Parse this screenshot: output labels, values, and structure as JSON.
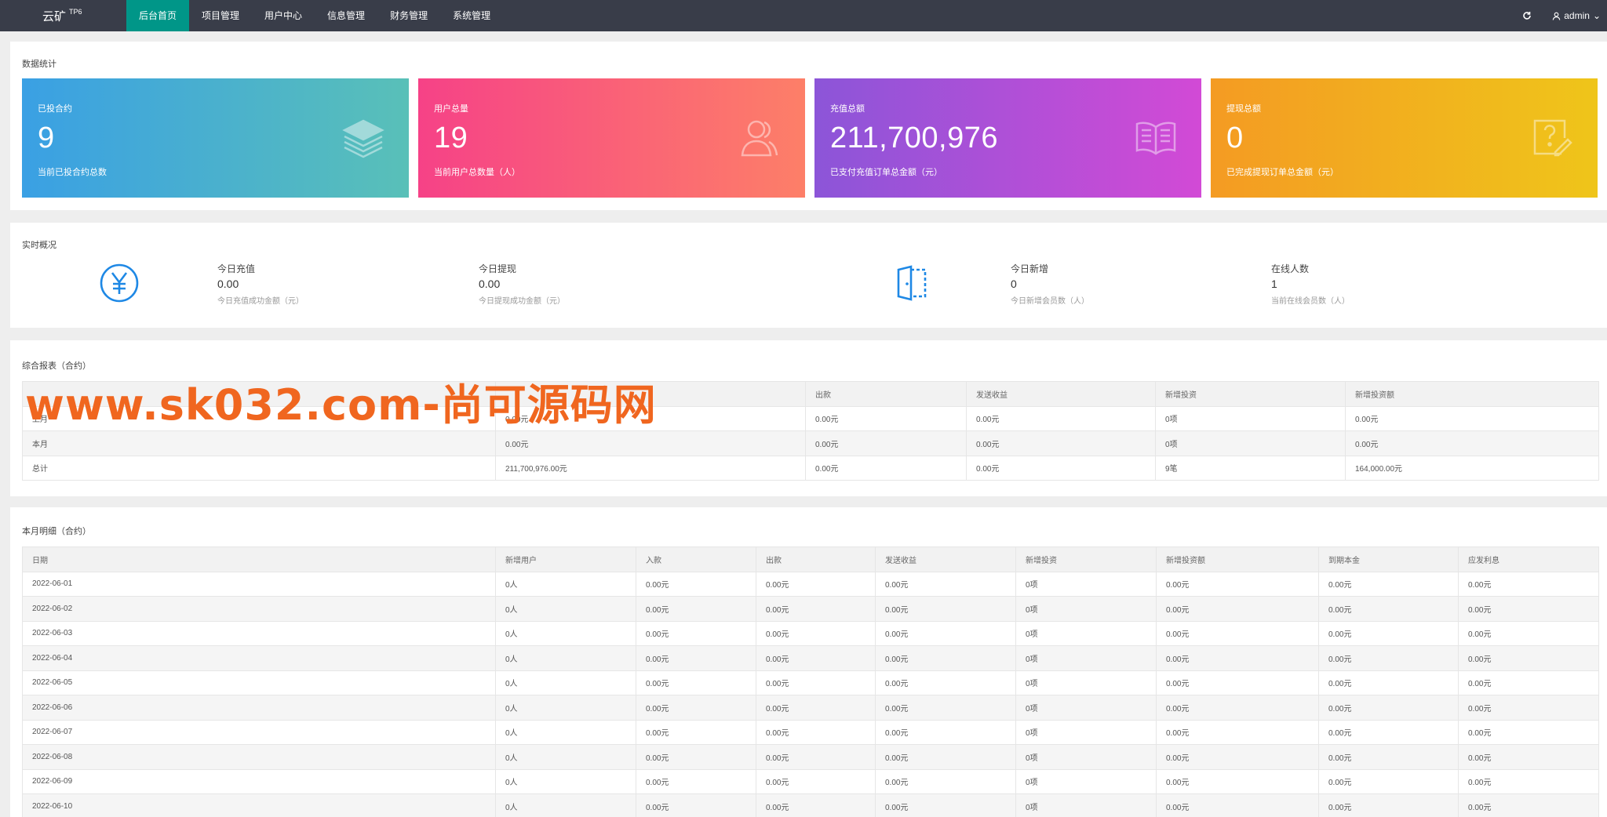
{
  "header": {
    "logo": "云矿",
    "logo_sup": "TP6",
    "nav": [
      "后台首页",
      "项目管理",
      "用户中心",
      "信息管理",
      "财务管理",
      "系统管理"
    ],
    "user": "admin"
  },
  "stats": {
    "title": "数据统计",
    "cards": [
      {
        "label": "已投合约",
        "value": "9",
        "sub": "当前已投合约总数",
        "icon": "stack-icon"
      },
      {
        "label": "用户总量",
        "value": "19",
        "sub": "当前用户总数量（人）",
        "icon": "users-icon"
      },
      {
        "label": "充值总额",
        "value": "211,700,976",
        "sub": "已支付充值订单总金额（元）",
        "icon": "book-icon"
      },
      {
        "label": "提现总额",
        "value": "0",
        "sub": "已完成提现订单总金额（元）",
        "icon": "question-edit-icon"
      }
    ]
  },
  "overview": {
    "title": "实时概况",
    "items": [
      {
        "label": "今日充值",
        "value": "0.00",
        "sub": "今日充值成功金额（元）"
      },
      {
        "label": "今日提现",
        "value": "0.00",
        "sub": "今日提现成功金额（元）"
      },
      {
        "label": "今日新增",
        "value": "0",
        "sub": "今日新增会员数（人）"
      },
      {
        "label": "在线人数",
        "value": "1",
        "sub": "当前在线会员数（人）"
      }
    ]
  },
  "report": {
    "title": "综合报表（合约）",
    "headers": [
      "",
      "",
      "出款",
      "发送收益",
      "新增投资",
      "新增投资额"
    ],
    "rows": [
      [
        "上月",
        "0.00元",
        "0.00元",
        "0.00元",
        "0项",
        "0.00元"
      ],
      [
        "本月",
        "0.00元",
        "0.00元",
        "0.00元",
        "0项",
        "0.00元"
      ],
      [
        "总计",
        "211,700,976.00元",
        "0.00元",
        "0.00元",
        "9笔",
        "164,000.00元"
      ]
    ]
  },
  "watermark": "www.sk032.com-尚可源码网",
  "detail": {
    "title": "本月明细（合约）",
    "headers": [
      "日期",
      "新增用户",
      "入款",
      "出款",
      "发送收益",
      "新增投资",
      "新增投资额",
      "到期本金",
      "应发利息"
    ],
    "rows": [
      [
        "2022-06-01",
        "0人",
        "0.00元",
        "0.00元",
        "0.00元",
        "0项",
        "0.00元",
        "0.00元",
        "0.00元"
      ],
      [
        "2022-06-02",
        "0人",
        "0.00元",
        "0.00元",
        "0.00元",
        "0项",
        "0.00元",
        "0.00元",
        "0.00元"
      ],
      [
        "2022-06-03",
        "0人",
        "0.00元",
        "0.00元",
        "0.00元",
        "0项",
        "0.00元",
        "0.00元",
        "0.00元"
      ],
      [
        "2022-06-04",
        "0人",
        "0.00元",
        "0.00元",
        "0.00元",
        "0项",
        "0.00元",
        "0.00元",
        "0.00元"
      ],
      [
        "2022-06-05",
        "0人",
        "0.00元",
        "0.00元",
        "0.00元",
        "0项",
        "0.00元",
        "0.00元",
        "0.00元"
      ],
      [
        "2022-06-06",
        "0人",
        "0.00元",
        "0.00元",
        "0.00元",
        "0项",
        "0.00元",
        "0.00元",
        "0.00元"
      ],
      [
        "2022-06-07",
        "0人",
        "0.00元",
        "0.00元",
        "0.00元",
        "0项",
        "0.00元",
        "0.00元",
        "0.00元"
      ],
      [
        "2022-06-08",
        "0人",
        "0.00元",
        "0.00元",
        "0.00元",
        "0项",
        "0.00元",
        "0.00元",
        "0.00元"
      ],
      [
        "2022-06-09",
        "0人",
        "0.00元",
        "0.00元",
        "0.00元",
        "0项",
        "0.00元",
        "0.00元",
        "0.00元"
      ],
      [
        "2022-06-10",
        "0人",
        "0.00元",
        "0.00元",
        "0.00元",
        "0项",
        "0.00元",
        "0.00元",
        "0.00元"
      ]
    ]
  },
  "colors": {
    "topbar": "#393d49",
    "nav_active": "#009688",
    "card_gradients": [
      [
        "#3aa0e4",
        "#59c0b8"
      ],
      [
        "#f64287",
        "#fd7f68"
      ],
      [
        "#8c55d8",
        "#d24ad6"
      ],
      [
        "#f49b23",
        "#efc51a"
      ]
    ]
  }
}
